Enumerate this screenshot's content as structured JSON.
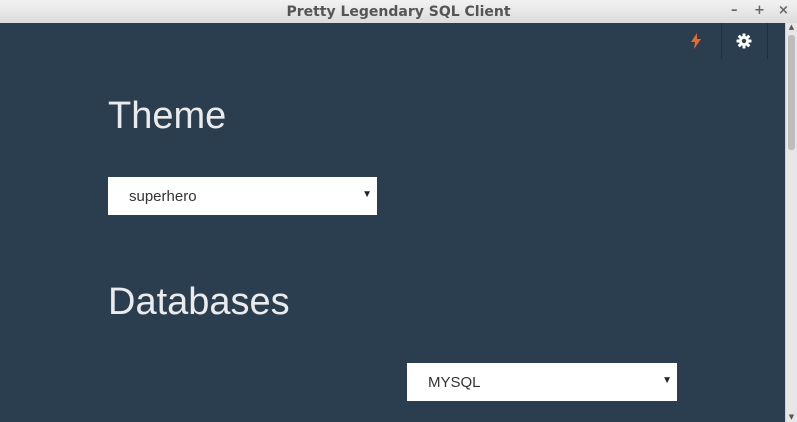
{
  "window": {
    "title": "Pretty Legendary SQL Client",
    "minimize": "–",
    "maximize": "+",
    "close": "×"
  },
  "toolbar": {
    "connect_icon": "lightning-icon",
    "settings_icon": "gear-icon",
    "accent": "#e8692b"
  },
  "theme": {
    "heading": "Theme",
    "selected": "superhero"
  },
  "databases": {
    "heading": "Databases",
    "selected": "MYSQL"
  },
  "colors": {
    "background": "#2b3e50",
    "heading": "#ebebeb"
  }
}
